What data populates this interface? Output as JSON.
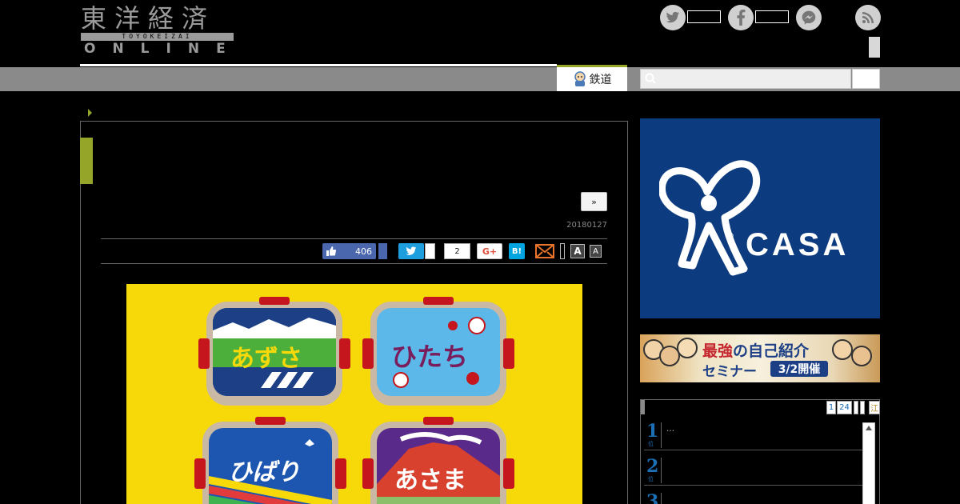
{
  "header": {
    "logo_kanji": "東洋経済",
    "logo_roman": "TOYOKEIZAI",
    "logo_online": "ONLINE"
  },
  "nav": {
    "tab_label": "鉄道",
    "search_placeholder": ""
  },
  "article": {
    "next_label": "»",
    "date": "20180127",
    "share": {
      "like_count": "406",
      "line_count": "2",
      "gplus_label": "G+",
      "hatena_label": "B!",
      "font_large": "A",
      "font_small": "A"
    },
    "photo_labels": [
      "あずさ",
      "ひたち",
      "ひばり",
      "あさま"
    ]
  },
  "sidebar": {
    "ad_casa": {
      "word": "CASA",
      "reg": "®"
    },
    "ad_seminar": {
      "line1_red": "最強",
      "line1_rest": "の自己紹介",
      "line2": "セミナー",
      "date_tag": "3/2開催"
    },
    "ranking": {
      "tabs": [
        "1",
        "24",
        "",
        "",
        "江"
      ],
      "rows": [
        {
          "num": "1",
          "unit": "位",
          "text": "…"
        },
        {
          "num": "2",
          "unit": "位",
          "text": ""
        },
        {
          "num": "3",
          "unit": "位",
          "text": ""
        }
      ]
    }
  },
  "colors": {
    "accent_green": "#94a52a",
    "nav_gray": "#8a8a8a",
    "casa_blue": "#0d3b7f",
    "rank_blue": "#1c6fb5"
  }
}
